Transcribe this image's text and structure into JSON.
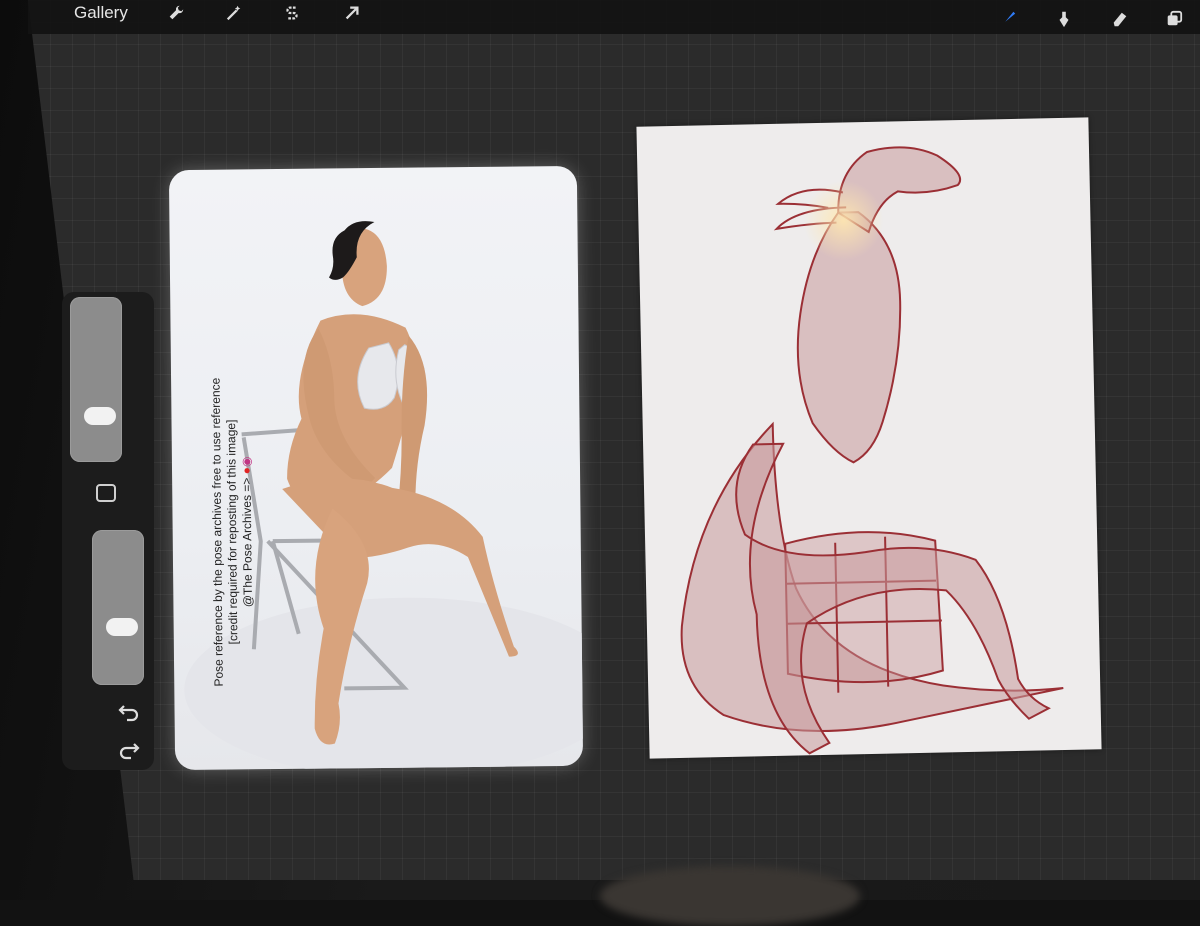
{
  "toolbar": {
    "gallery_label": "Gallery",
    "left_icons": [
      "wrench-icon",
      "magic-wand-icon",
      "selection-s-icon",
      "move-arrow-icon"
    ],
    "right_icons": [
      "brush-icon",
      "smudge-icon",
      "eraser-icon",
      "layers-icon"
    ],
    "active_tool_color": "#2f7bf6"
  },
  "sidebar": {
    "brush_size_level": 0.75,
    "opacity_level": 0.6,
    "modify_button_icon": "square-icon",
    "undo_icon": "undo-icon",
    "redo_icon": "redo-icon"
  },
  "reference_photo": {
    "credit_line_1": "Pose reference by the pose archives free to use reference",
    "credit_line_2": "[credit required for reposting of this image]",
    "credit_line_3": "@The Pose Archives =>"
  },
  "colors": {
    "canvas_bg": "#2b2b2b",
    "sketch_stroke": "#9b2f35",
    "sketch_fill": "#c89a9c"
  }
}
